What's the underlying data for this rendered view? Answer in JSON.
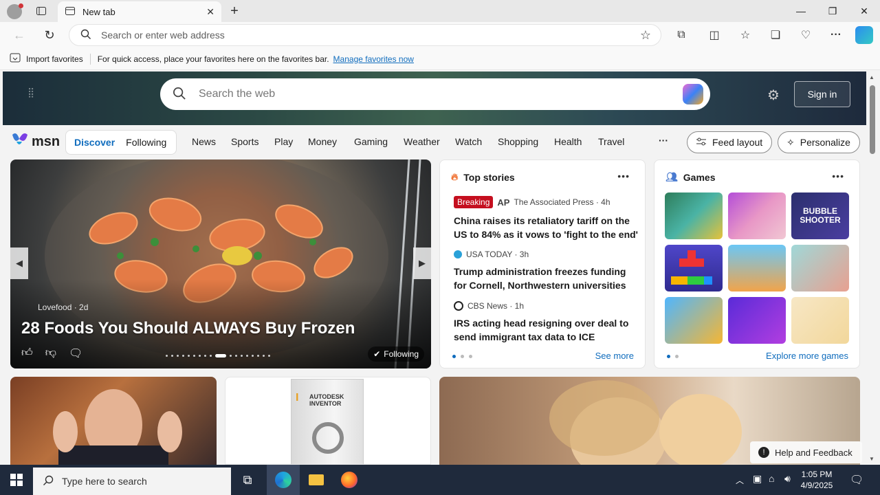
{
  "browser": {
    "tab_title": "New tab",
    "address_placeholder": "Search or enter web address"
  },
  "favorites_bar": {
    "import_label": "Import favorites",
    "hint": "For quick access, place your favorites here on the favorites bar.",
    "manage_link": "Manage favorites now"
  },
  "msn": {
    "search_placeholder": "Search the web",
    "sign_in": "Sign in",
    "logo_text": "msn",
    "segments": [
      "Discover",
      "Following"
    ],
    "nav": [
      "News",
      "Sports",
      "Play",
      "Money",
      "Gaming",
      "Weather",
      "Watch",
      "Shopping",
      "Health",
      "Travel"
    ],
    "more": "···",
    "feed_layout": "Feed layout",
    "personalize": "Personalize"
  },
  "hero_card": {
    "source": "Lovefood · 2d",
    "headline": "28 Foods You Should ALWAYS Buy Frozen",
    "following": "Following"
  },
  "top_stories": {
    "title": "Top stories",
    "see_more": "See more",
    "items": [
      {
        "badge": "Breaking",
        "source": "The Associated Press · 4h",
        "title": "China raises its retaliatory tariff on the US to 84% as it vows to 'fight to the end'"
      },
      {
        "source": "USA TODAY · 3h",
        "title": "Trump administration freezes funding for Cornell, Northwestern universities"
      },
      {
        "source": "CBS News · 1h",
        "title": "IRS acting head resigning over deal to send immigrant tax data to ICE"
      }
    ]
  },
  "games": {
    "title": "Games",
    "explore": "Explore more games",
    "tile_texts": [
      "BUBBLE SHOOTER"
    ]
  },
  "lower_cards": {
    "autodesk_label": "AUTODESK INVENTOR"
  },
  "help": {
    "label": "Help and Feedback"
  },
  "taskbar": {
    "search_placeholder": "Type here to search",
    "time": "1:05 PM",
    "date": "4/9/2025"
  },
  "colors": {
    "accent": "#0f6cbd",
    "breaking": "#c50f1f",
    "taskbar": "#1f2a3c"
  }
}
